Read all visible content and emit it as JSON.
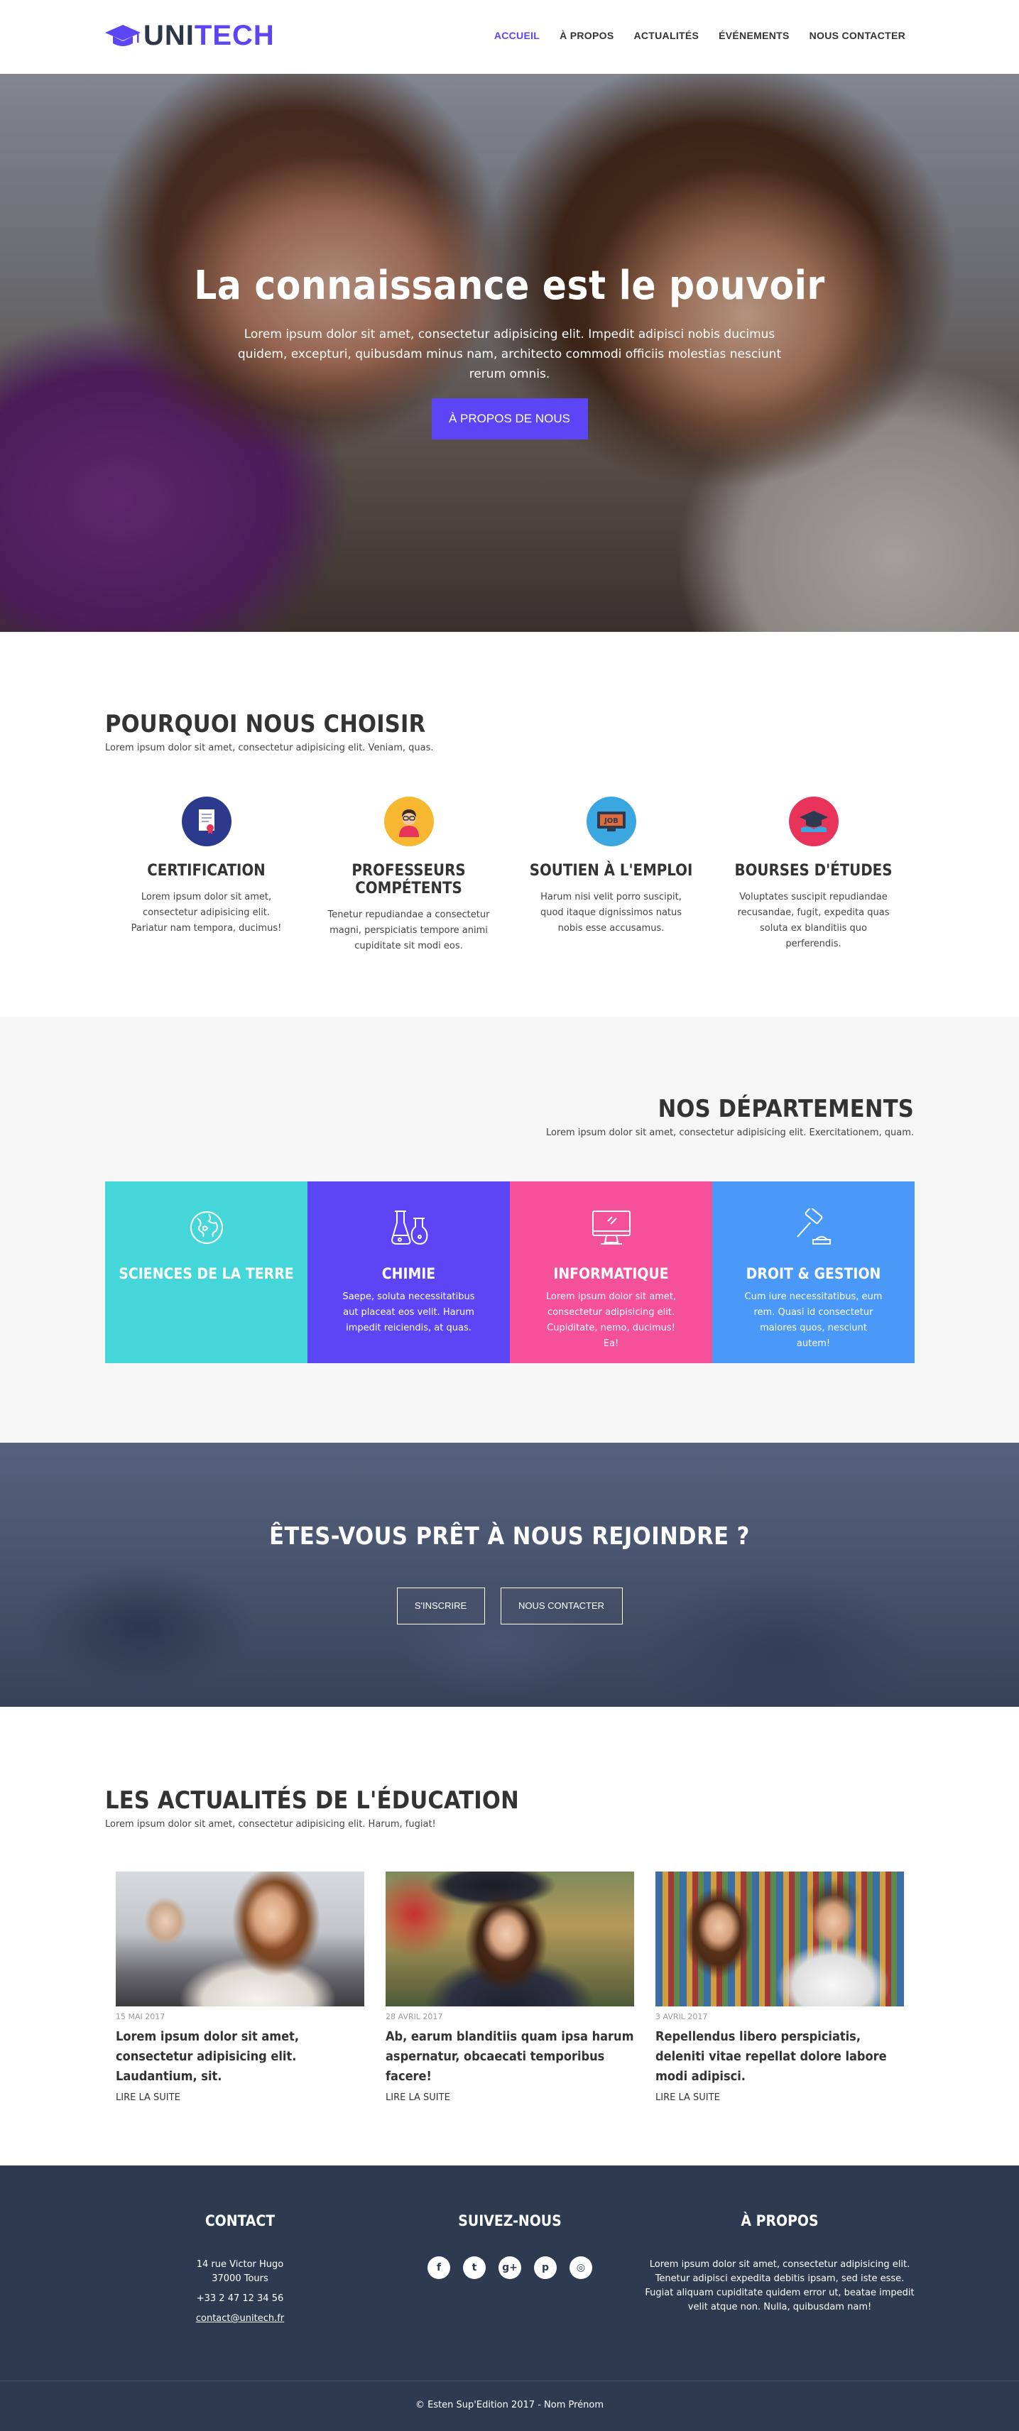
{
  "brand": {
    "name_part1": "UNI",
    "name_part2": "TECH",
    "color": "#5b45f5"
  },
  "nav": {
    "items": [
      {
        "label": "ACCUEIL",
        "active": true
      },
      {
        "label": "À PROPOS",
        "active": false
      },
      {
        "label": "ACTUALITÉS",
        "active": false
      },
      {
        "label": "ÉVÉNEMENTS",
        "active": false
      },
      {
        "label": "NOUS CONTACTER",
        "active": false
      }
    ]
  },
  "hero": {
    "title": "La connaissance est le pouvoir",
    "text": "Lorem ipsum dolor sit amet, consectetur adipisicing elit. Impedit adipisci nobis ducimus quidem, excepturi, quibusdam minus nam, architecto commodi officiis molestias nesciunt rerum omnis.",
    "button": "À PROPOS DE NOUS"
  },
  "why": {
    "title": "POURQUOI NOUS CHOISIR",
    "subtitle": "Lorem ipsum dolor sit amet, consectetur adipisicing elit. Veniam, quas.",
    "features": [
      {
        "icon": "certificate-icon",
        "title": "CERTIFICATION",
        "text": "Lorem ipsum dolor sit amet, consectetur adipisicing elit. Pariatur nam tempora, ducimus!",
        "color": "#2b3a8c"
      },
      {
        "icon": "teacher-icon",
        "title": "PROFESSEURS COMPÉTENTS",
        "text": "Tenetur repudiandae a consectetur magni, perspiciatis tempore animi cupiditate sit modi eos.",
        "color": "#f7b731"
      },
      {
        "icon": "job-icon",
        "title": "SOUTIEN À L'EMPLOI",
        "text": "Harum nisi velit porro suscipit, quod itaque dignissimos natus nobis esse accusamus.",
        "color": "#3aa7e0"
      },
      {
        "icon": "scholarship-icon",
        "title": "BOURSES D'ÉTUDES",
        "text": "Voluptates suscipit repudiandae recusandae, fugit, expedita quas soluta ex blanditiis quo perferendis.",
        "color": "#e8345a"
      }
    ]
  },
  "departments": {
    "title": "NOS DÉPARTEMENTS",
    "subtitle": "Lorem ipsum dolor sit amet, consectetur adipisicing elit. Exercitationem, quam.",
    "items": [
      {
        "icon": "globe-icon",
        "title": "SCIENCES DE LA TERRE",
        "text": "",
        "color": "#45d6d9"
      },
      {
        "icon": "flask-icon",
        "title": "CHIMIE",
        "text": "Saepe, soluta necessitatibus aut placeat eos velit. Harum impedit reiciendis, at quas.",
        "color": "#5b45f5"
      },
      {
        "icon": "computer-icon",
        "title": "INFORMATIQUE",
        "text": "Lorem ipsum dolor sit amet, consectetur adipisicing elit. Cupiditate, nemo, ducimus! Ea!",
        "color": "#f5509a"
      },
      {
        "icon": "gavel-icon",
        "title": "DROIT & GESTION",
        "text": "Cum iure necessitatibus, eum rem. Quasi id consectetur maiores quos, nesciunt autem!",
        "color": "#4a98f7"
      }
    ]
  },
  "cta": {
    "title": "ÊTES-VOUS PRÊT À NOUS REJOINDRE ?",
    "button_signup": "S'INSCRIRE",
    "button_contact": "NOUS CONTACTER"
  },
  "news": {
    "title": "LES ACTUALITÉS DE L'ÉDUCATION",
    "subtitle": "Lorem ipsum dolor sit amet, consectetur adipisicing elit. Harum, fugiat!",
    "read_more": "LIRE LA SUITE",
    "articles": [
      {
        "date": "15 MAI 2017",
        "title": "Lorem ipsum dolor sit amet, consectetur adipisicing elit. Laudantium, sit."
      },
      {
        "date": "28 AVRIL 2017",
        "title": "Ab, earum blanditiis quam ipsa harum aspernatur, obcaecati temporibus facere!"
      },
      {
        "date": "3 AVRIL 2017",
        "title": "Repellendus libero perspiciatis, deleniti vitae repellat dolore labore modi adipisci."
      }
    ]
  },
  "footer": {
    "contact_title": "CONTACT",
    "address_line1": "14 rue Victor Hugo",
    "address_line2": "37000 Tours",
    "phone": "+33 2 47 12 34 56",
    "email": "contact@unitech.fr",
    "social_title": "SUIVEZ-NOUS",
    "socials": [
      "facebook-icon",
      "twitter-icon",
      "google-plus-icon",
      "pinterest-icon",
      "instagram-icon"
    ],
    "social_glyphs": [
      "f",
      "t",
      "g+",
      "p",
      "◎"
    ],
    "about_title": "À PROPOS",
    "about_text": "Lorem ipsum dolor sit amet, consectetur adipisicing elit. Tenetur adipisci expedita debitis ipsam, sed iste esse. Fugiat aliquam cupiditate quidem error ut, beatae impedit velit atque non. Nulla, quibusdam nam!",
    "copyright": "© Esten Sup'Edition 2017 - Nom Prénom"
  }
}
